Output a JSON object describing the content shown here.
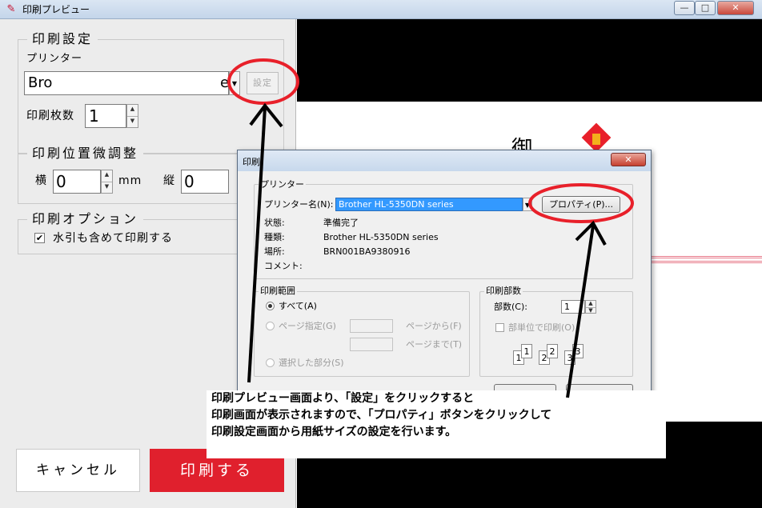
{
  "window": {
    "title": "印刷プレビュー",
    "controls": {
      "minimize": "—",
      "maximize": "□",
      "close": "✕"
    }
  },
  "left_panel": {
    "print_settings": {
      "legend": "印刷設定",
      "printer_label": "プリンター",
      "printer_value": "Bro",
      "settings_button": "設定",
      "copies_label": "印刷枚数",
      "copies_value": "1"
    },
    "position_adjust": {
      "legend": "印刷位置微調整",
      "horizontal_label": "横",
      "horizontal_value": "0",
      "unit": "mm",
      "vertical_label": "縦",
      "vertical_value": "0"
    },
    "options": {
      "legend": "印刷オプション",
      "watermark_label": "水引も含めて印刷する",
      "watermark_checked": true
    },
    "cancel_button": "キャンセル",
    "print_button": "印刷する"
  },
  "preview": {
    "visible_char": "御"
  },
  "print_dialog": {
    "title": "印刷",
    "close": "✕",
    "printer_group": {
      "legend": "プリンター",
      "name_label": "プリンター名(N):",
      "name_value": "Brother HL-5350DN series",
      "properties_button": "プロパティ(P)...",
      "rows": [
        {
          "label": "状態:",
          "value": "準備完了"
        },
        {
          "label": "種類:",
          "value": "Brother HL-5350DN series"
        },
        {
          "label": "場所:",
          "value": "BRN001BA9380916"
        },
        {
          "label": "コメント:",
          "value": ""
        }
      ]
    },
    "range_group": {
      "legend": "印刷範囲",
      "all": "すべて(A)",
      "pages": "ページ指定(G)",
      "from": "ページから(F)",
      "to": "ページまで(T)",
      "selection": "選択した部分(S)"
    },
    "copies_group": {
      "legend": "印刷部数",
      "count_label": "部数(C):",
      "count_value": "1",
      "collate": "部単位で印刷(O)",
      "pages": [
        "1",
        "1",
        "2",
        "2",
        "3",
        "3"
      ]
    }
  },
  "annotation": {
    "lines": [
      "印刷プレビュー画面より、「設定」をクリックすると",
      "印刷画面が表示されますので、「プロパティ」ボタンをクリックして",
      "印刷設定画面から用紙サイズの設定を行います。"
    ]
  },
  "colors": {
    "accent_red": "#e0202d",
    "annotation_red": "#e8202a",
    "selection_blue": "#3399ff"
  }
}
